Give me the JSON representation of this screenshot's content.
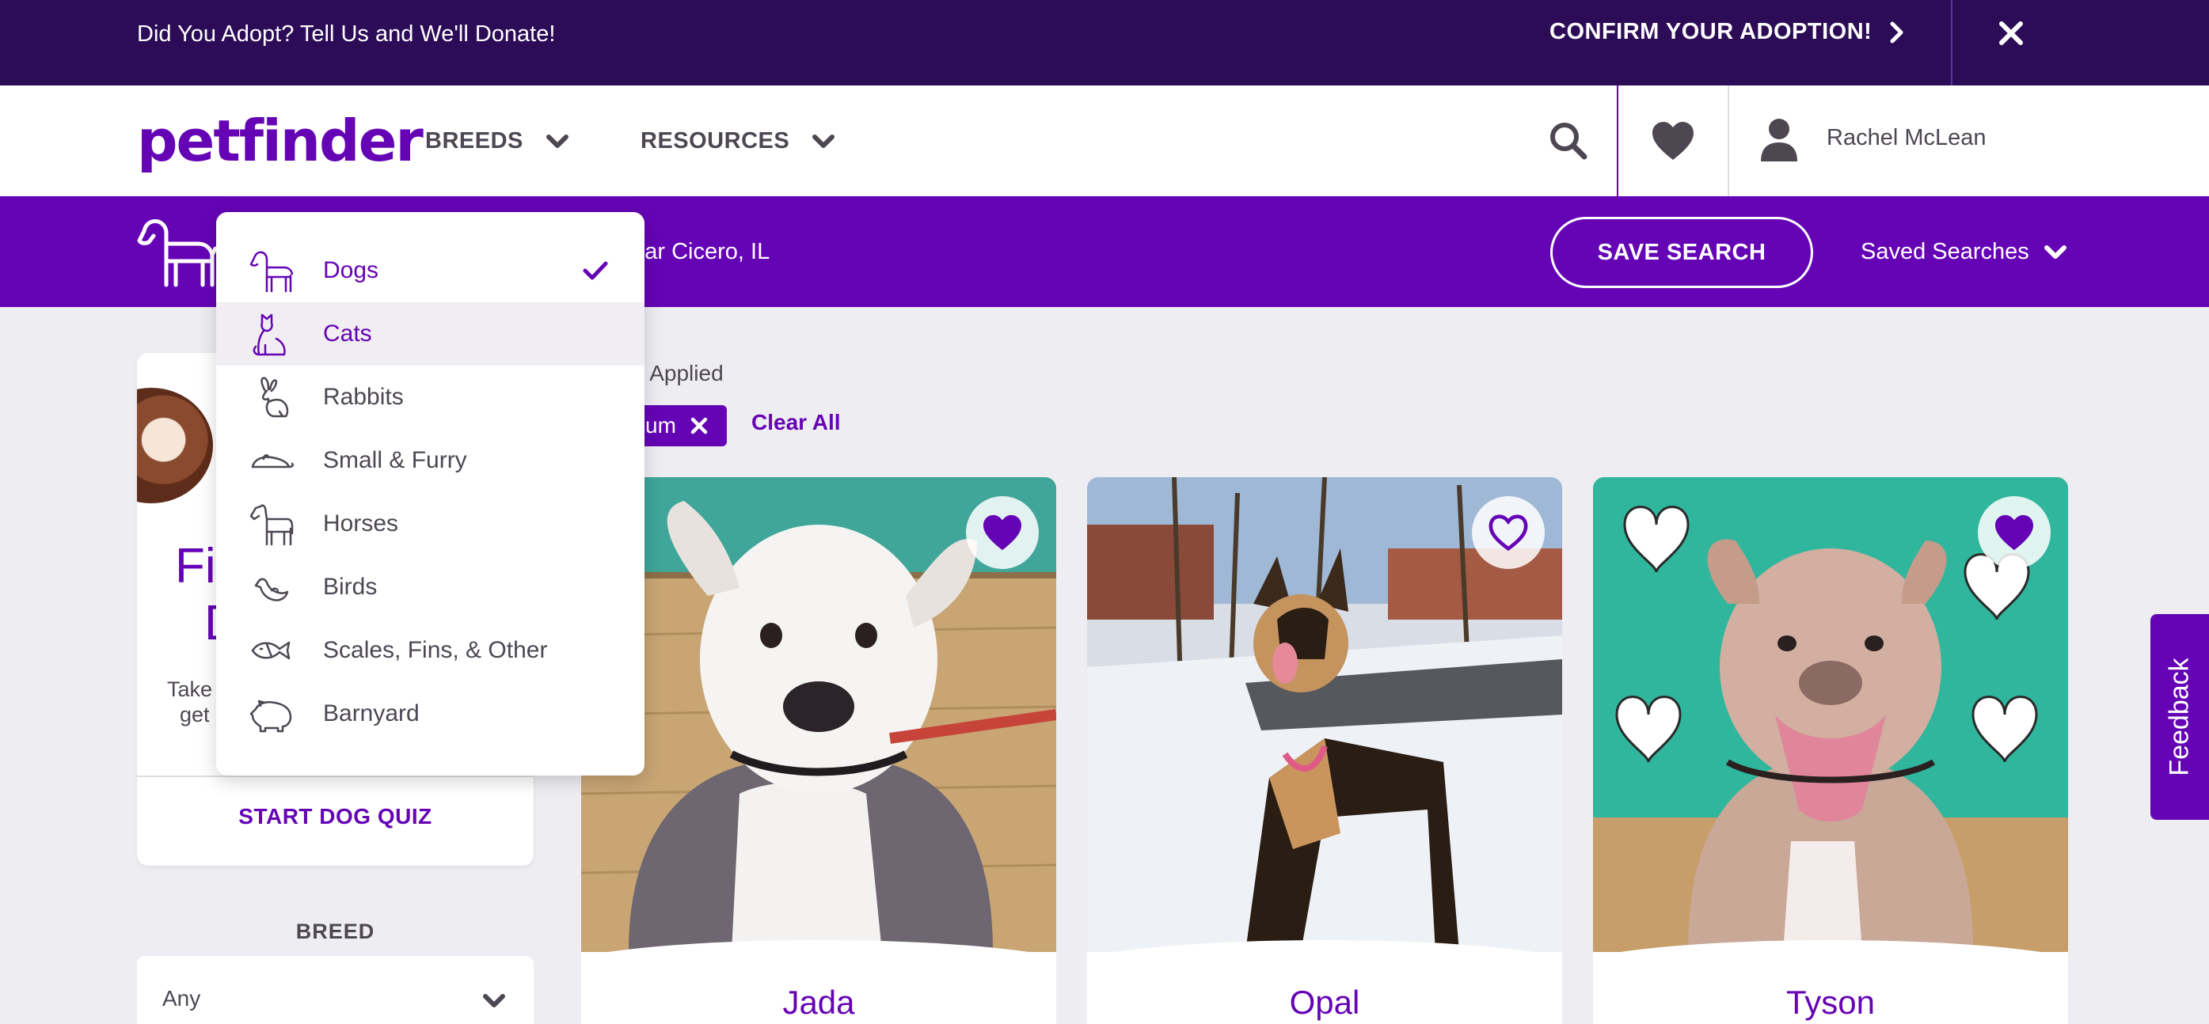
{
  "announcement": {
    "message": "Did You Adopt? Tell Us and We'll Donate!",
    "confirm_label": "CONFIRM YOUR ADOPTION!"
  },
  "header": {
    "logo_text": "petfinder",
    "nav": [
      {
        "label": "BREEDS"
      },
      {
        "label": "RESOURCES"
      }
    ],
    "user_name": "Rachel McLean"
  },
  "search_bar": {
    "location_text": "near Cicero, IL",
    "save_search_label": "SAVE SEARCH",
    "saved_searches_label": "Saved Searches"
  },
  "animal_dropdown": {
    "items": [
      {
        "label": "Dogs",
        "icon": "dog-icon",
        "selected": true
      },
      {
        "label": "Cats",
        "icon": "cat-icon",
        "hovered": true
      },
      {
        "label": "Rabbits",
        "icon": "rabbit-icon"
      },
      {
        "label": "Small & Furry",
        "icon": "mouse-icon"
      },
      {
        "label": "Horses",
        "icon": "horse-icon"
      },
      {
        "label": "Birds",
        "icon": "bird-icon"
      },
      {
        "label": "Scales, Fins, & Other",
        "icon": "fish-icon"
      },
      {
        "label": "Barnyard",
        "icon": "pig-icon"
      }
    ]
  },
  "quiz_card": {
    "title_line1": "Fi",
    "title_line2": "D",
    "text_line1": "Take",
    "text_line2": "get",
    "button_label": "START DOG QUIZ"
  },
  "filters": {
    "applied_label": "s Applied",
    "chip_label": "um",
    "clear_all_label": "Clear All",
    "breed_heading": "BREED",
    "breed_value": "Any"
  },
  "pets": [
    {
      "name": "Jada",
      "favorited": true
    },
    {
      "name": "Opal",
      "favorited": false
    },
    {
      "name": "Tyson",
      "favorited": true
    }
  ],
  "feedback_label": "Feedback",
  "colors": {
    "brand_purple": "#6504b5",
    "announce_bg": "#2d0c57",
    "page_bg": "#eeedf1"
  }
}
